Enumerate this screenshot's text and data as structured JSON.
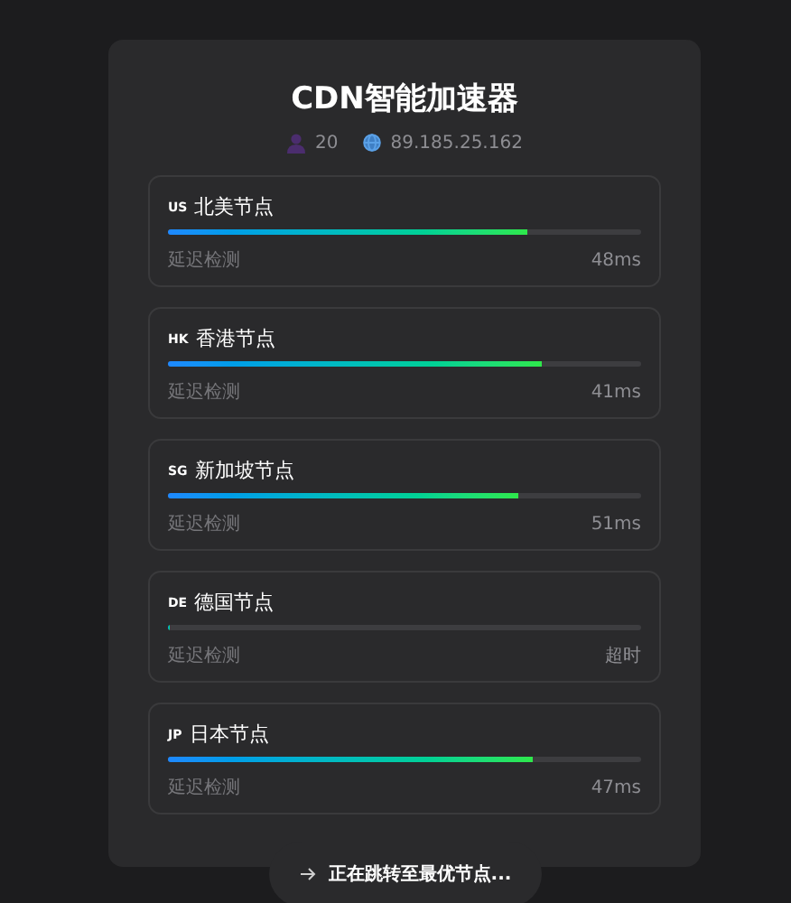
{
  "title": "CDN智能加速器",
  "meta": {
    "users": "20",
    "ip": "89.185.25.162"
  },
  "nodes": [
    {
      "code": "US",
      "name": "北美节点",
      "label": "延迟检测",
      "latency": "48ms",
      "level": 0.76
    },
    {
      "code": "HK",
      "name": "香港节点",
      "label": "延迟检测",
      "latency": "41ms",
      "level": 0.79
    },
    {
      "code": "SG",
      "name": "新加坡节点",
      "label": "延迟检测",
      "latency": "51ms",
      "level": 0.74
    },
    {
      "code": "DE",
      "name": "德国节点",
      "label": "延迟检测",
      "latency": "超时",
      "level": 0
    },
    {
      "code": "JP",
      "name": "日本节点",
      "label": "延迟检测",
      "latency": "47ms",
      "level": 0.77
    }
  ],
  "toast": {
    "text": "正在跳转至最优节点..."
  }
}
